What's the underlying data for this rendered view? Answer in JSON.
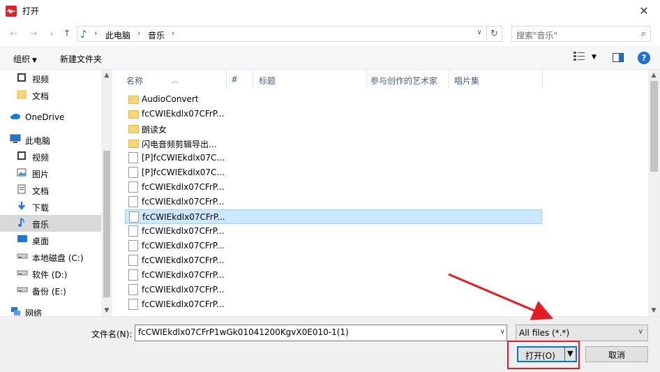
{
  "window": {
    "title": "打开"
  },
  "address": {
    "crumbs": [
      "此电脑",
      "音乐"
    ]
  },
  "search": {
    "placeholder": "搜索\"音乐\""
  },
  "toolbar": {
    "organize": "组织",
    "new_folder": "新建文件夹"
  },
  "nav": {
    "items": [
      {
        "label": "视频",
        "icon": "video-icon"
      },
      {
        "label": "文档",
        "icon": "folder-icon"
      },
      {
        "label": "OneDrive",
        "icon": "cloud-icon"
      },
      {
        "label": "此电脑",
        "icon": "computer-icon"
      },
      {
        "label": "视频",
        "icon": "video-icon"
      },
      {
        "label": "图片",
        "icon": "picture-icon"
      },
      {
        "label": "文档",
        "icon": "document-icon"
      },
      {
        "label": "下载",
        "icon": "download-icon"
      },
      {
        "label": "音乐",
        "icon": "music-icon",
        "selected": true
      },
      {
        "label": "桌面",
        "icon": "desktop-icon"
      },
      {
        "label": "本地磁盘 (C:)",
        "icon": "drive-icon"
      },
      {
        "label": "软件 (D:)",
        "icon": "drive-icon"
      },
      {
        "label": "备份 (E:)",
        "icon": "drive-icon"
      },
      {
        "label": "网络",
        "icon": "network-icon"
      }
    ]
  },
  "columns": [
    "名称",
    "#",
    "标题",
    "参与创作的艺术家",
    "唱片集"
  ],
  "files": [
    {
      "name": "AudioConvert",
      "type": "folder"
    },
    {
      "name": "fcCWIEkdlx07CFrP...",
      "type": "folder"
    },
    {
      "name": "朗读女",
      "type": "folder"
    },
    {
      "name": "闪电音频剪辑导出...",
      "type": "folder"
    },
    {
      "name": "[P]fcCWIEkdlx07C...",
      "type": "file"
    },
    {
      "name": "[P]fcCWIEkdlx07C...",
      "type": "file"
    },
    {
      "name": "fcCWIEkdlx07CFrP...",
      "type": "file"
    },
    {
      "name": "fcCWIEkdlx07CFrP...",
      "type": "file"
    },
    {
      "name": "fcCWIEkdlx07CFrP...",
      "type": "file",
      "selected": true
    },
    {
      "name": "fcCWIEkdlx07CFrP...",
      "type": "file"
    },
    {
      "name": "fcCWIEkdlx07CFrP...",
      "type": "file"
    },
    {
      "name": "fcCWIEkdlx07CFrP...",
      "type": "file"
    },
    {
      "name": "fcCWIEkdlx07CFrP...",
      "type": "file"
    },
    {
      "name": "fcCWIEkdlx07CFrP...",
      "type": "file"
    },
    {
      "name": "fcCWIEkdlx07CFrP...",
      "type": "file"
    }
  ],
  "bottom": {
    "filename_label": "文件名(N):",
    "filename_value": "fcCWIEkdlx07CFrP1wGk01041200KgvX0E010-1(1)",
    "filter": "All files (*.*)",
    "open": "打开(O)",
    "cancel": "取消"
  },
  "colors": {
    "accent": "#0078d7",
    "selected_row": "#cce8ff",
    "annotation_red": "#e51c23"
  }
}
